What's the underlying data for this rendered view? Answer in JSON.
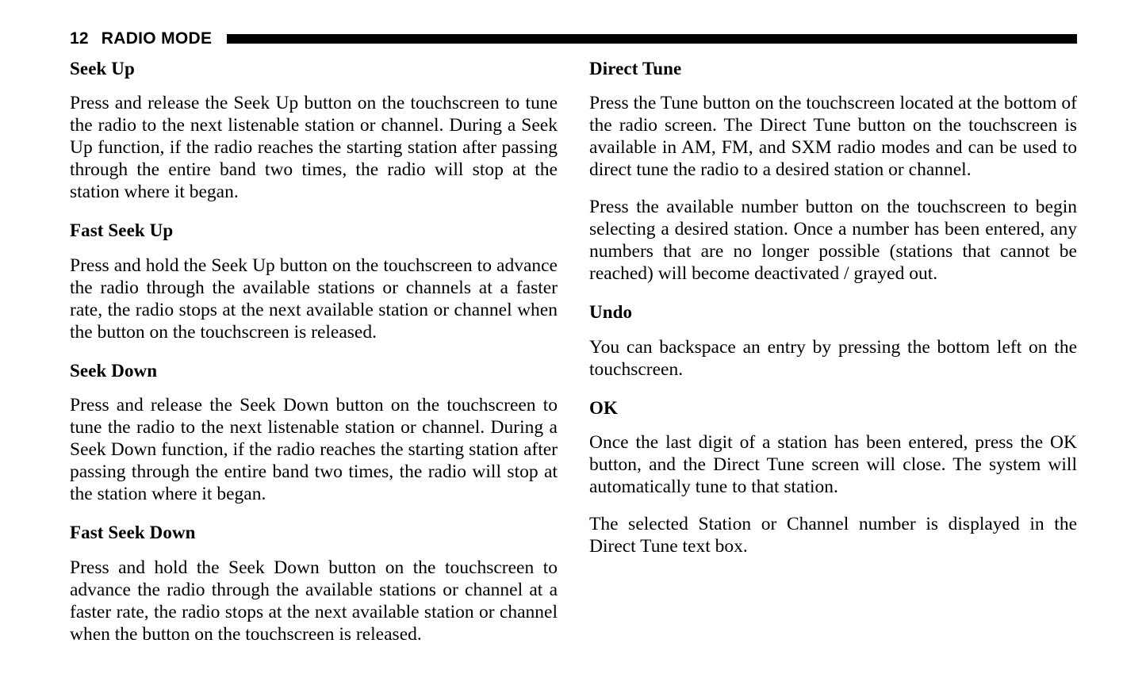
{
  "header": {
    "page_number": "12",
    "title": "RADIO MODE"
  },
  "left_column": {
    "sections": [
      {
        "heading": "Seek Up",
        "paragraphs": [
          "Press and release the Seek Up button on the touchscreen to tune the radio to the next listenable station or channel. During a Seek Up function, if the radio reaches the starting station after passing through the entire band two times, the radio will stop at the station where it began."
        ]
      },
      {
        "heading": "Fast Seek Up",
        "paragraphs": [
          "Press and hold the Seek Up button on the touchscreen to advance the radio through the available stations or channels at a faster rate, the radio stops at the next available station or channel when the button on the touchscreen is released."
        ]
      },
      {
        "heading": "Seek Down",
        "paragraphs": [
          "Press and release the Seek Down button on the touchscreen to tune the radio to the next listenable station or channel. During a Seek Down function, if the radio reaches the starting station after passing through the entire band two times, the radio will stop at the station where it began."
        ]
      },
      {
        "heading": "Fast Seek Down",
        "paragraphs": [
          "Press and hold the Seek Down button on the touchscreen to advance the radio through the available stations or channel at a faster rate, the radio stops at the next available station or channel when the button on the touchscreen is released."
        ]
      }
    ]
  },
  "right_column": {
    "sections": [
      {
        "heading": "Direct Tune",
        "paragraphs": [
          "Press the Tune button on the touchscreen located at the bottom of the radio screen. The Direct Tune button on the touchscreen is available in AM, FM, and SXM radio modes and can be used to direct tune the radio to a desired station or channel.",
          "Press the available number button on the touchscreen to begin selecting a desired station. Once a number has been entered, any numbers that are no longer possible (stations that cannot be reached) will become deactivated / grayed out."
        ]
      },
      {
        "heading": "Undo",
        "paragraphs": [
          "You can backspace an entry by pressing the bottom left on the touchscreen."
        ]
      },
      {
        "heading": "OK",
        "paragraphs": [
          "Once the last digit of a station has been entered, press the OK button, and the Direct Tune screen will close. The system will automatically tune to that station.",
          "The selected Station or Channel number is displayed in the Direct Tune text box."
        ]
      }
    ]
  }
}
